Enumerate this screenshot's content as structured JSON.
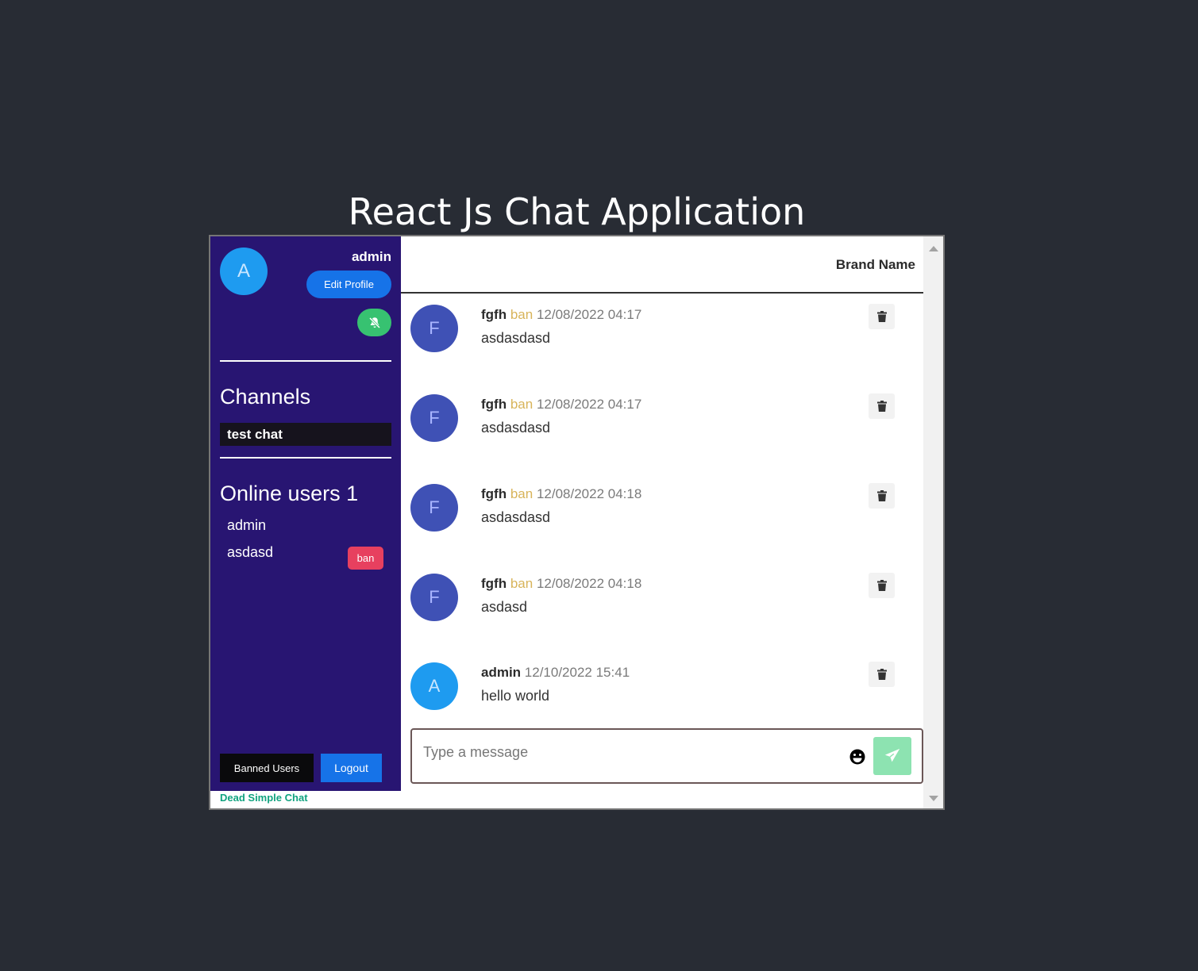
{
  "page": {
    "title": "React Js Chat Application"
  },
  "sidebar": {
    "avatar_initial": "A",
    "username": "admin",
    "edit_profile_label": "Edit Profile",
    "notification_icon": "bell-slash-icon",
    "channels_title": "Channels",
    "channels": [
      {
        "label": "test chat"
      }
    ],
    "online_users_title": "Online users",
    "online_count": "1",
    "online_users": [
      {
        "name": "admin"
      },
      {
        "name": "asdasd"
      }
    ],
    "ban_label": "ban",
    "banned_users_label": "Banned Users",
    "logout_label": "Logout",
    "footer_brand": "Dead Simple Chat"
  },
  "chat": {
    "brand_name": "Brand Name",
    "messages": [
      {
        "initial": "F",
        "author": "fgfh",
        "ban": "ban",
        "time": "12/08/2022 04:17",
        "text": "asdasdasd"
      },
      {
        "initial": "F",
        "author": "fgfh",
        "ban": "ban",
        "time": "12/08/2022 04:17",
        "text": "asdasdasd"
      },
      {
        "initial": "F",
        "author": "fgfh",
        "ban": "ban",
        "time": "12/08/2022 04:18",
        "text": "asdasdasd"
      },
      {
        "initial": "F",
        "author": "fgfh",
        "ban": "ban",
        "time": "12/08/2022 04:18",
        "text": "asdasd"
      },
      {
        "initial": "A",
        "author": "admin",
        "ban": "",
        "time": "12/10/2022 15:41",
        "text": "hello world"
      }
    ],
    "composer": {
      "placeholder": "Type a message",
      "emoji_icon": "smiley-icon",
      "send_icon": "paper-plane-icon"
    }
  },
  "colors": {
    "background": "#282c34",
    "sidebar": "#281572",
    "accent_blue": "#1673e8",
    "toggle_green": "#37c271",
    "ban_red": "#e7405f",
    "send_green": "#8de3b1",
    "msg_avatar_f": "#3f51b5",
    "msg_avatar_a": "#1e9bf0"
  }
}
